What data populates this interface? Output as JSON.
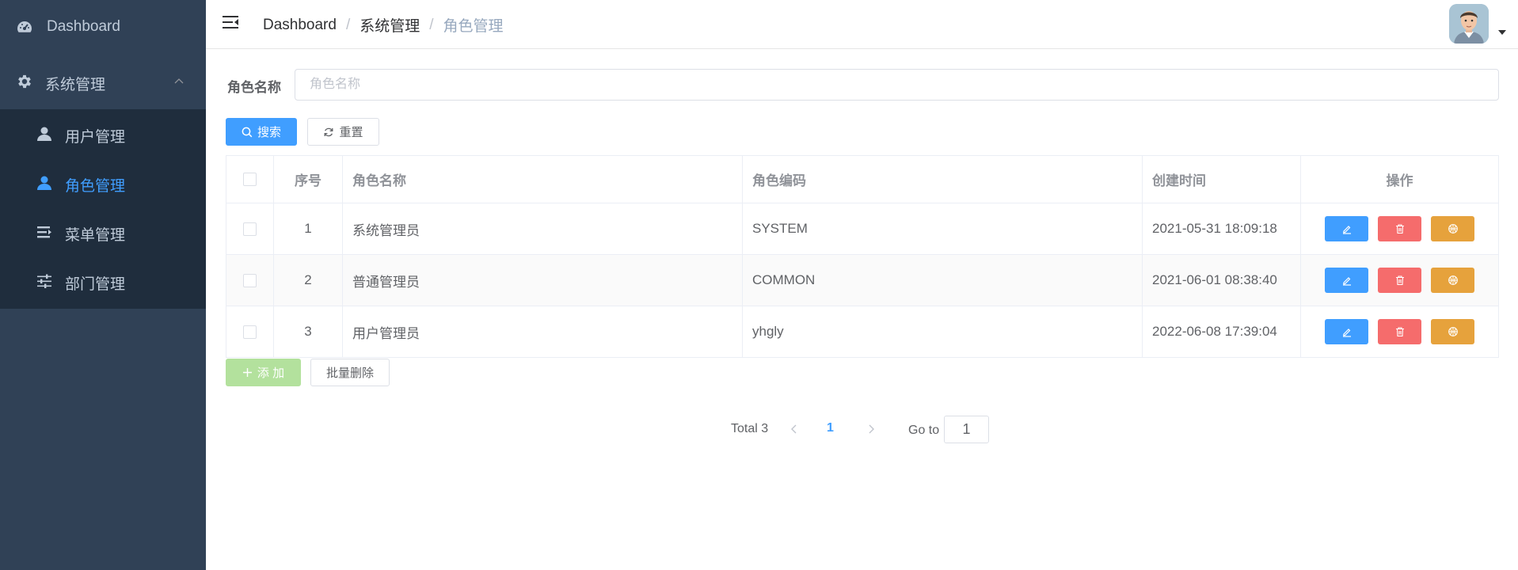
{
  "sidebar": {
    "dashboard_label": "Dashboard",
    "system_label": "系统管理",
    "items": [
      {
        "label": "用户管理"
      },
      {
        "label": "角色管理"
      },
      {
        "label": "菜单管理"
      },
      {
        "label": "部门管理"
      }
    ],
    "active_index": 1
  },
  "header": {
    "breadcrumb": [
      "Dashboard",
      "系统管理",
      "角色管理"
    ],
    "separator": "/"
  },
  "search": {
    "label": "角色名称",
    "placeholder": "角色名称",
    "value": "",
    "search_button": "搜索",
    "reset_button": "重置"
  },
  "table": {
    "columns": [
      "序号",
      "角色名称",
      "角色编码",
      "创建时间",
      "操作"
    ],
    "rows": [
      {
        "index": "1",
        "name": "系统管理员",
        "code": "SYSTEM",
        "created": "2021-05-31 18:09:18"
      },
      {
        "index": "2",
        "name": "普通管理员",
        "code": "COMMON",
        "created": "2021-06-01 08:38:40"
      },
      {
        "index": "3",
        "name": "用户管理员",
        "code": "yhgly",
        "created": "2022-06-08 17:39:04"
      }
    ]
  },
  "actions": {
    "add_button": "添 加",
    "batch_delete_button": "批量删除"
  },
  "pagination": {
    "total_text": "Total 3",
    "current_page": "1",
    "goto_label": "Go to",
    "goto_value": "1"
  },
  "colors": {
    "sidebar_bg": "#304156",
    "submenu_bg": "#1f2d3d",
    "primary": "#409eff",
    "danger": "#f56c6c",
    "warning": "#e6a23c",
    "success_disabled": "#b3e19d"
  }
}
